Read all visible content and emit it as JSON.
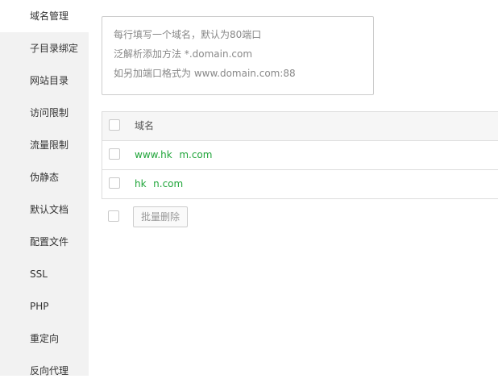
{
  "sidebar": {
    "items": [
      {
        "label": "域名管理",
        "active": true
      },
      {
        "label": "子目录绑定"
      },
      {
        "label": "网站目录"
      },
      {
        "label": "访问限制"
      },
      {
        "label": "流量限制"
      },
      {
        "label": "伪静态"
      },
      {
        "label": "默认文档"
      },
      {
        "label": "配置文件"
      },
      {
        "label": "SSL"
      },
      {
        "label": "PHP"
      },
      {
        "label": "重定向"
      },
      {
        "label": "反向代理"
      }
    ]
  },
  "domain_input": {
    "hint_lines": [
      "每行填写一个域名，默认为80端口",
      "泛解析添加方法 *.domain.com",
      "如另加端口格式为 www.domain.com:88"
    ]
  },
  "table": {
    "header": "域名",
    "rows": [
      {
        "domain": "www.hk   m.com"
      },
      {
        "domain": "hk   n.com"
      }
    ]
  },
  "bulk": {
    "delete_label": "批量删除"
  },
  "colors": {
    "link": "#20a53a",
    "sidebar_bg": "#f2f2f2"
  }
}
